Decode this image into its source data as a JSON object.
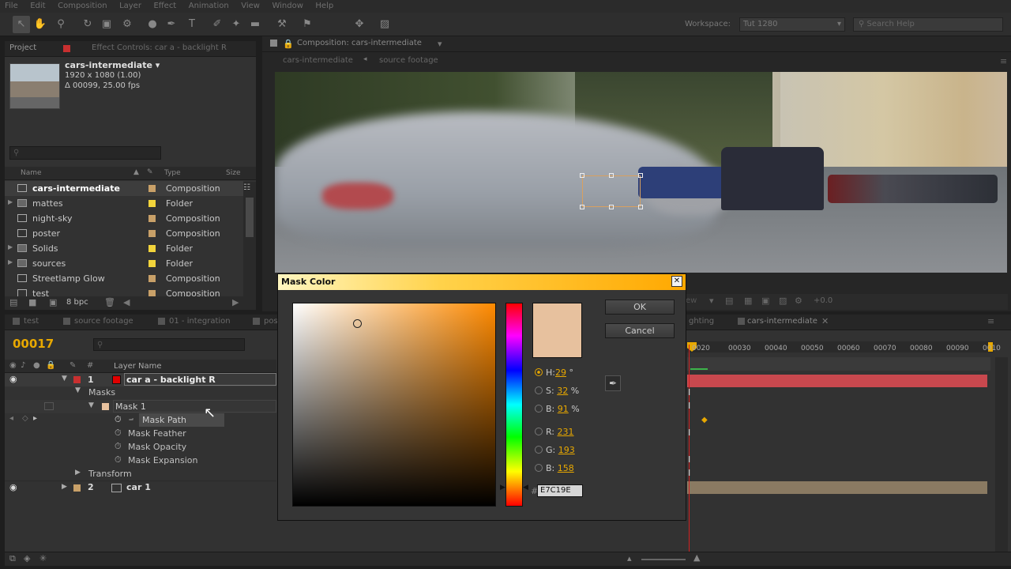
{
  "menu": [
    "File",
    "Edit",
    "Composition",
    "Layer",
    "Effect",
    "Animation",
    "View",
    "Window",
    "Help"
  ],
  "workspace": {
    "label": "Workspace:",
    "value": "Tut 1280",
    "search_placeholder": "Search Help"
  },
  "project": {
    "tab_project": "Project",
    "tab_effect": "Effect Controls: car a - backlight R",
    "comp_name": "cars-intermediate ▾",
    "comp_res": "1920 x 1080 (1.00)",
    "comp_dur": "Δ 00099, 25.00 fps",
    "col_name": "Name",
    "col_type": "Type",
    "col_size": "Size",
    "bpc": "8 bpc",
    "items": [
      {
        "name": "cars-intermediate",
        "type": "Composition",
        "label_color": "#c8a068",
        "folder": false
      },
      {
        "name": "mattes",
        "type": "Folder",
        "label_color": "#f2d43b",
        "folder": true
      },
      {
        "name": "night-sky",
        "type": "Composition",
        "label_color": "#c8a068",
        "folder": false
      },
      {
        "name": "poster",
        "type": "Composition",
        "label_color": "#c8a068",
        "folder": false
      },
      {
        "name": "Solids",
        "type": "Folder",
        "label_color": "#f2d43b",
        "folder": true
      },
      {
        "name": "sources",
        "type": "Folder",
        "label_color": "#f2d43b",
        "folder": true
      },
      {
        "name": "Streetlamp Glow",
        "type": "Composition",
        "label_color": "#c8a068",
        "folder": false
      },
      {
        "name": "test",
        "type": "Composition",
        "label_color": "#c8a068",
        "folder": false
      }
    ]
  },
  "viewer": {
    "tab": "Composition: cars-intermediate",
    "crumb1": "cars-intermediate",
    "crumb2": "source footage",
    "zoom_offset": "+0.0"
  },
  "timeline": {
    "tabs": [
      "test",
      "source footage",
      "01 - integration",
      "pos"
    ],
    "right_tabs": [
      "ghting",
      "cars-intermediate"
    ],
    "timecode": "00017",
    "col_layer_name": "Layer Name",
    "rows": {
      "layer1_num": "1",
      "layer1_name": "car a - backlight R",
      "masks": "Masks",
      "mask1": "Mask 1",
      "mask_path": "Mask Path",
      "mask_feather": "Mask Feather",
      "mask_opacity": "Mask Opacity",
      "mask_expansion": "Mask Expansion",
      "transform": "Transform",
      "layer2_num": "2",
      "layer2_name": "car 1"
    },
    "ruler": [
      "0020",
      "00030",
      "00040",
      "00050",
      "00060",
      "00070",
      "00080",
      "00090",
      "0010"
    ]
  },
  "dialog": {
    "title": "Mask Color",
    "ok": "OK",
    "cancel": "Cancel",
    "h_label": "H:",
    "h_value": "29",
    "h_unit": "°",
    "s_label": "S:",
    "s_value": "32",
    "s_unit": "%",
    "b_label": "B:",
    "b_value": "91",
    "b_unit": "%",
    "r_label": "R:",
    "r_value": "231",
    "g_label": "G:",
    "g_value": "193",
    "b2_label": "B:",
    "b2_value": "158",
    "hex_label": "#",
    "hex_value": "E7C19E",
    "swatch_color": "#e7c19e",
    "hue_color": "#ff8a00"
  }
}
